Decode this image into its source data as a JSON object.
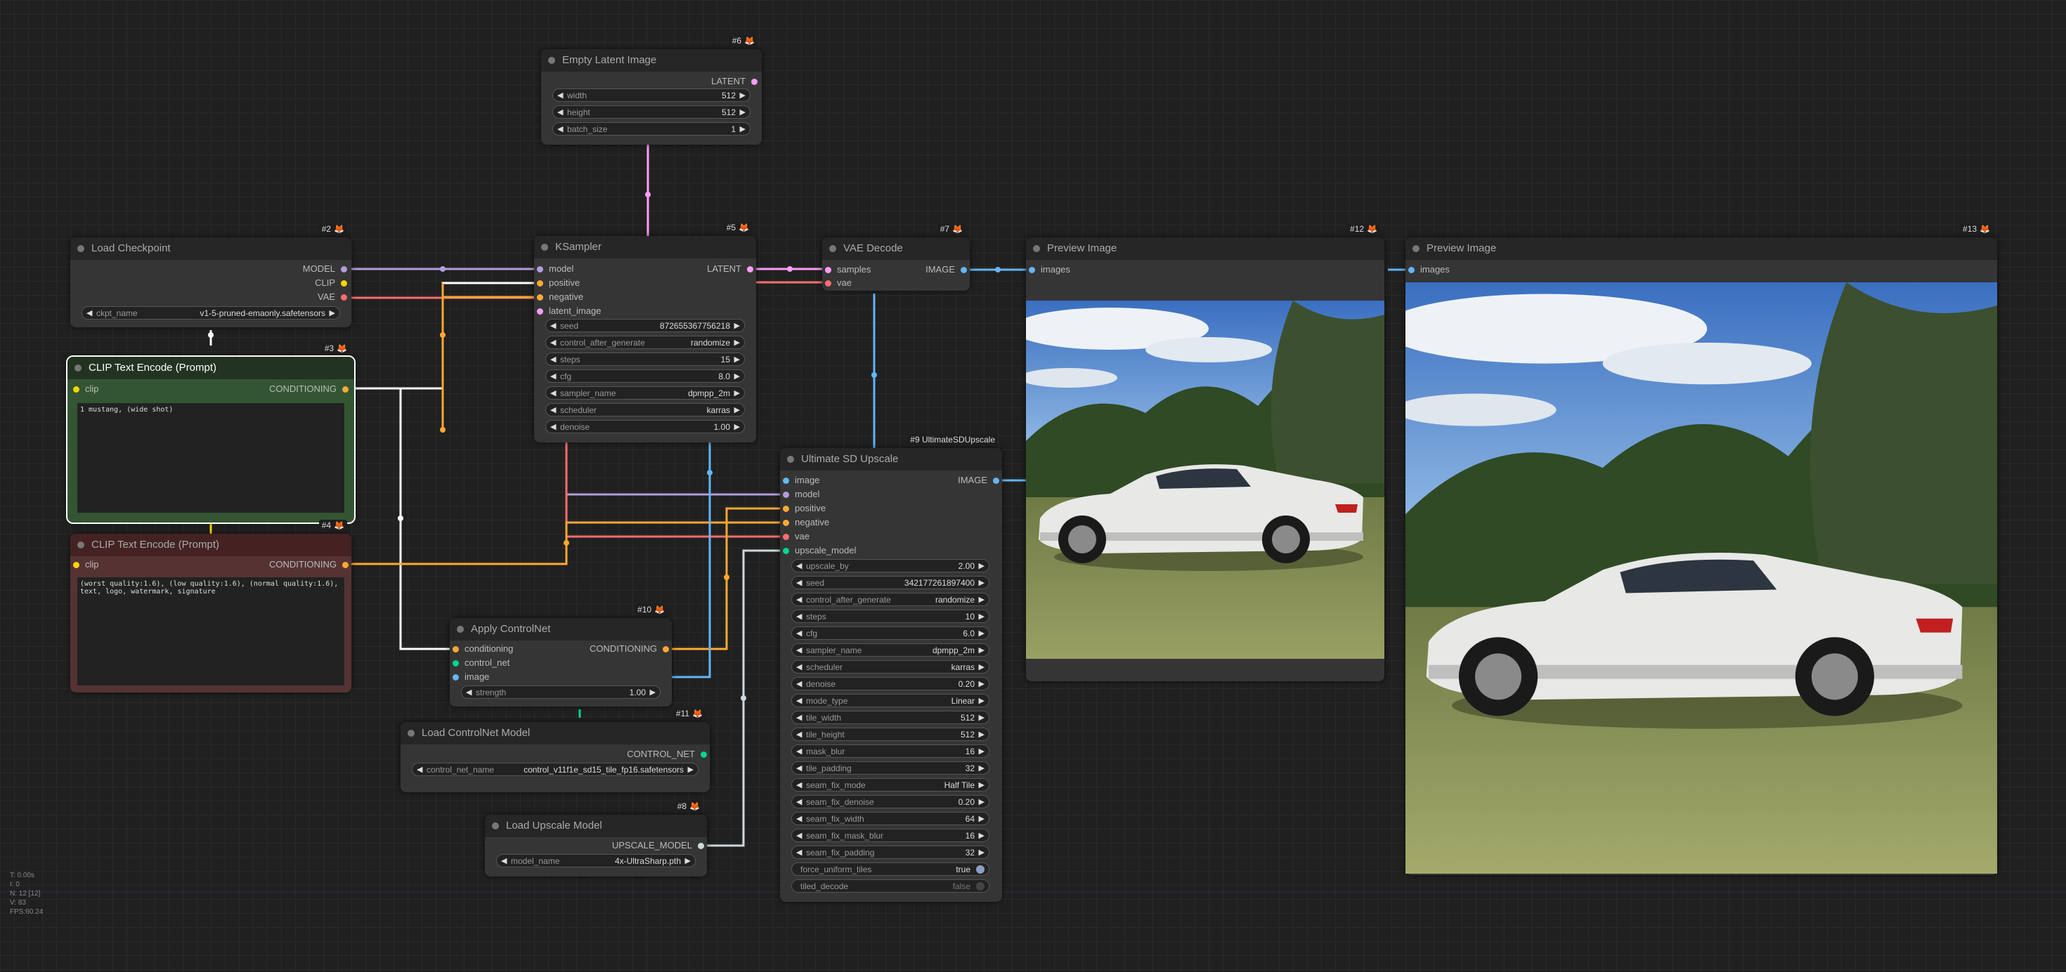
{
  "colors": {
    "model": "#b39ddb",
    "clip": "#ffd500",
    "vae": "#ff6e6e",
    "conditioning": "#ffa931",
    "latent": "#ff9cf9",
    "image": "#64b5f6",
    "control_net": "#00d78d",
    "upscale_model": "#cfd8dc"
  },
  "nodes": {
    "empty_latent": {
      "id": "#6",
      "title": "Empty Latent Image",
      "out_latent": "LATENT",
      "w_width_label": "width",
      "w_width_value": "512",
      "w_height_label": "height",
      "w_height_value": "512",
      "w_batch_label": "batch_size",
      "w_batch_value": "1"
    },
    "load_checkpoint": {
      "id": "#2",
      "title": "Load Checkpoint",
      "out_model": "MODEL",
      "out_clip": "CLIP",
      "out_vae": "VAE",
      "w_ckpt_label": "ckpt_name",
      "w_ckpt_value": "v1-5-pruned-emaonly.safetensors"
    },
    "clip_pos": {
      "id": "#3",
      "title": "CLIP Text Encode (Prompt)",
      "in_clip": "clip",
      "out_cond": "CONDITIONING",
      "text": "1 mustang, (wide shot)"
    },
    "clip_neg": {
      "id": "#4",
      "title": "CLIP Text Encode (Prompt)",
      "in_clip": "clip",
      "out_cond": "CONDITIONING",
      "text": "(worst quality:1.6), (low quality:1.6), (normal quality:1.6), text, logo, watermark, signature"
    },
    "ksampler": {
      "id": "#5",
      "title": "KSampler",
      "in_model": "model",
      "in_positive": "positive",
      "in_negative": "negative",
      "in_latent": "latent_image",
      "out_latent": "LATENT",
      "w": [
        {
          "label": "seed",
          "value": "872655367756218"
        },
        {
          "label": "control_after_generate",
          "value": "randomize"
        },
        {
          "label": "steps",
          "value": "15"
        },
        {
          "label": "cfg",
          "value": "8.0"
        },
        {
          "label": "sampler_name",
          "value": "dpmpp_2m"
        },
        {
          "label": "scheduler",
          "value": "karras"
        },
        {
          "label": "denoise",
          "value": "1.00"
        }
      ]
    },
    "vae_decode": {
      "id": "#7",
      "title": "VAE Decode",
      "in_samples": "samples",
      "in_vae": "vae",
      "out_image": "IMAGE"
    },
    "preview12": {
      "id": "#12",
      "title": "Preview Image",
      "in_images": "images"
    },
    "preview13": {
      "id": "#13",
      "title": "Preview Image",
      "in_images": "images"
    },
    "ultimate": {
      "id": "#9 UltimateSDUpscale",
      "title": "Ultimate SD Upscale",
      "in_image": "image",
      "in_model": "model",
      "in_positive": "positive",
      "in_negative": "negative",
      "in_vae": "vae",
      "in_upscale_model": "upscale_model",
      "out_image": "IMAGE",
      "w": [
        {
          "label": "upscale_by",
          "value": "2.00"
        },
        {
          "label": "seed",
          "value": "342177261897400"
        },
        {
          "label": "control_after_generate",
          "value": "randomize"
        },
        {
          "label": "steps",
          "value": "10"
        },
        {
          "label": "cfg",
          "value": "6.0"
        },
        {
          "label": "sampler_name",
          "value": "dpmpp_2m"
        },
        {
          "label": "scheduler",
          "value": "karras"
        },
        {
          "label": "denoise",
          "value": "0.20"
        },
        {
          "label": "mode_type",
          "value": "Linear"
        },
        {
          "label": "tile_width",
          "value": "512"
        },
        {
          "label": "tile_height",
          "value": "512"
        },
        {
          "label": "mask_blur",
          "value": "16"
        },
        {
          "label": "tile_padding",
          "value": "32"
        },
        {
          "label": "seam_fix_mode",
          "value": "Half Tile"
        },
        {
          "label": "seam_fix_denoise",
          "value": "0.20"
        },
        {
          "label": "seam_fix_width",
          "value": "64"
        },
        {
          "label": "seam_fix_mask_blur",
          "value": "16"
        },
        {
          "label": "seam_fix_padding",
          "value": "32"
        }
      ],
      "t_force_label": "force_uniform_tiles",
      "t_force_value": "true",
      "t_tiled_label": "tiled_decode",
      "t_tiled_value": "false"
    },
    "apply_controlnet": {
      "id": "#10",
      "title": "Apply ControlNet",
      "in_conditioning": "conditioning",
      "in_control_net": "control_net",
      "in_image": "image",
      "out_cond": "CONDITIONING",
      "w_strength_label": "strength",
      "w_strength_value": "1.00"
    },
    "load_controlnet": {
      "id": "#11",
      "title": "Load ControlNet Model",
      "out": "CONTROL_NET",
      "w_label": "control_net_name",
      "w_value": "control_v11f1e_sd15_tile_fp16.safetensors"
    },
    "load_upscale": {
      "id": "#8",
      "title": "Load Upscale Model",
      "out": "UPSCALE_MODEL",
      "w_label": "model_name",
      "w_value": "4x-UltraSharp.pth"
    }
  },
  "hud": {
    "t": "T: 0.00s",
    "i": "I: 0",
    "n": "N: 12 [12]",
    "v": "V: 83",
    "fps": "FPS:60.24"
  }
}
